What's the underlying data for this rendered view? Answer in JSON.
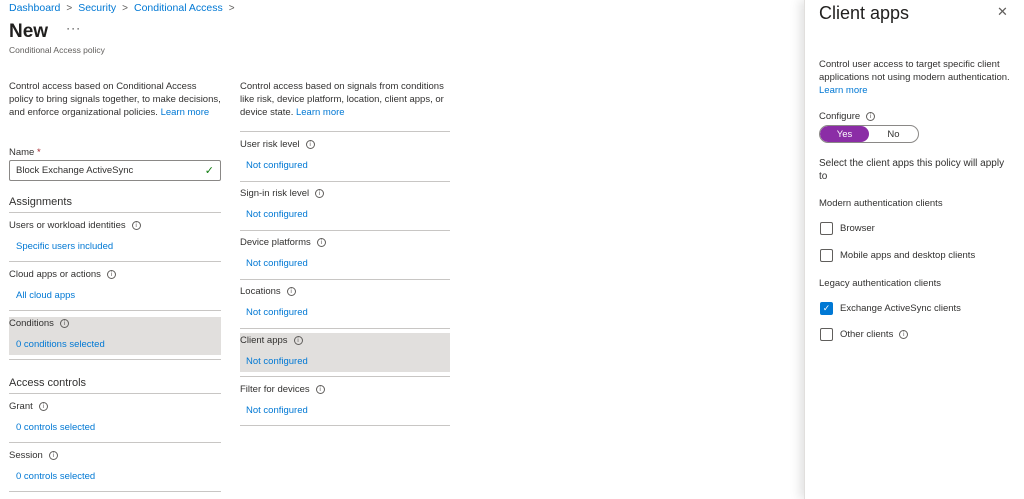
{
  "breadcrumb": [
    "Dashboard",
    "Security",
    "Conditional Access"
  ],
  "breadcrumb_sep": ">",
  "page": {
    "title": "New",
    "more": "···",
    "subtitle": "Conditional Access policy"
  },
  "left": {
    "description": "Control access based on Conditional Access policy to bring signals together, to make decisions, and enforce organizational policies.",
    "learn_more": "Learn more",
    "name_label": "Name",
    "required_mark": "*",
    "name_value": "Block Exchange ActiveSync",
    "assignments_head": "Assignments",
    "users_label": "Users or workload identities",
    "users_value": "Specific users included",
    "apps_label": "Cloud apps or actions",
    "apps_value": "All cloud apps",
    "conditions_label": "Conditions",
    "conditions_value": "0 conditions selected",
    "access_head": "Access controls",
    "grant_label": "Grant",
    "grant_value": "0 controls selected",
    "session_label": "Session",
    "session_value": "0 controls selected"
  },
  "middle": {
    "description": "Control access based on signals from conditions like risk, device platform, location, client apps, or device state.",
    "learn_more": "Learn more",
    "items": [
      {
        "label": "User risk level",
        "value": "Not configured"
      },
      {
        "label": "Sign-in risk level",
        "value": "Not configured"
      },
      {
        "label": "Device platforms",
        "value": "Not configured"
      },
      {
        "label": "Locations",
        "value": "Not configured"
      },
      {
        "label": "Client apps",
        "value": "Not configured"
      },
      {
        "label": "Filter for devices",
        "value": "Not configured"
      }
    ]
  },
  "panel": {
    "title": "Client apps",
    "close": "✕",
    "description": "Control user access to target specific client applications not using modern authentication.",
    "learn_more": "Learn more",
    "configure_label": "Configure",
    "toggle_yes": "Yes",
    "toggle_no": "No",
    "toggle_selected": "Yes",
    "select_text": "Select the client apps this policy will apply to",
    "modern_head": "Modern authentication clients",
    "browser": "Browser",
    "mobile": "Mobile apps and desktop clients",
    "legacy_head": "Legacy authentication clients",
    "exchange": "Exchange ActiveSync clients",
    "other": "Other clients",
    "checked": {
      "browser": false,
      "mobile": false,
      "exchange": true,
      "other": false
    }
  },
  "colors": {
    "accent": "#0078d4",
    "toggle_on": "#8b2da6",
    "highlight": "#e1dfdd",
    "required": "#a4262c"
  },
  "icons": {
    "info": "info-icon",
    "close": "close-icon",
    "check": "checkmark-icon",
    "more": "more-icon"
  }
}
